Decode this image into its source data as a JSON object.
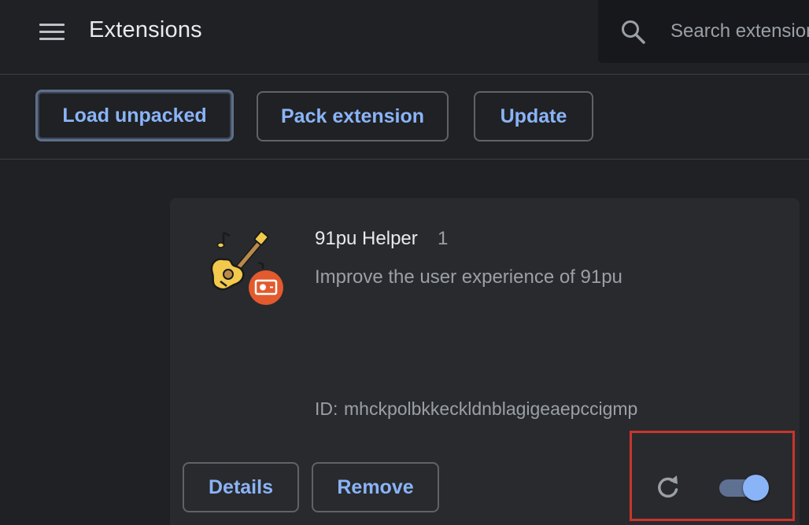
{
  "header": {
    "title": "Extensions",
    "menu_icon": "hamburger-menu-icon",
    "search": {
      "icon": "search-icon",
      "placeholder": "Search extensions"
    }
  },
  "toolbar": {
    "load_unpacked_label": "Load unpacked",
    "pack_extension_label": "Pack extension",
    "update_label": "Update"
  },
  "extension": {
    "name": "91pu Helper",
    "version": "1",
    "description": "Improve the user experience of 91pu",
    "id_label": "ID:",
    "id_value": "mhckpolbkkeckldnblagigeaepccigmp",
    "icon": "guitar-logo-icon",
    "details_label": "Details",
    "remove_label": "Remove",
    "reload_icon": "reload-icon",
    "enabled": true
  },
  "colors": {
    "background": "#202124",
    "card": "#292a2d",
    "accent": "#8ab4f8",
    "highlight": "#c9352c"
  }
}
